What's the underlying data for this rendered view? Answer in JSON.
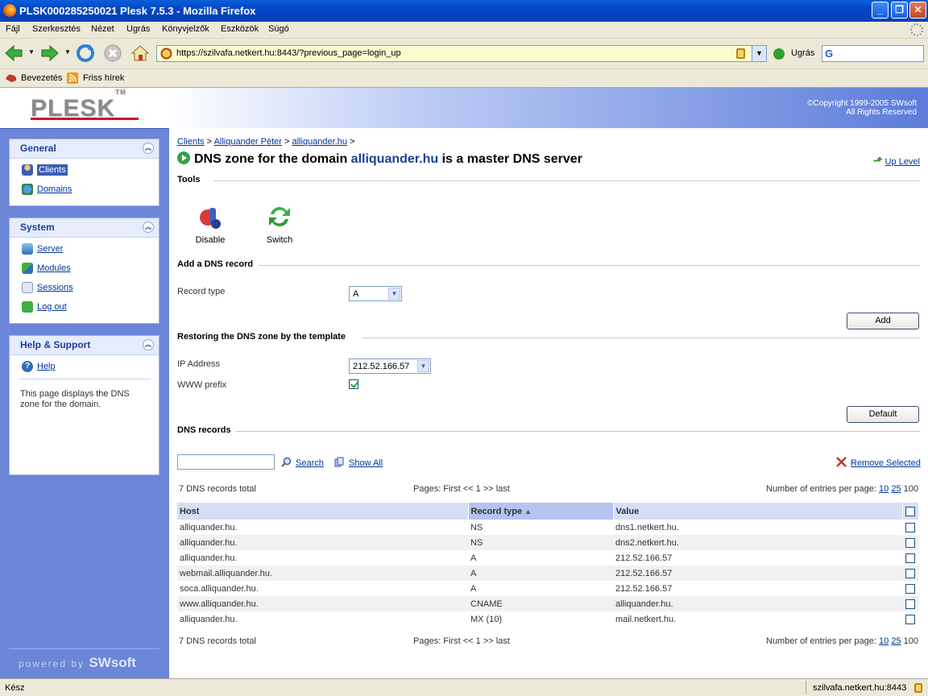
{
  "window": {
    "title": "PLSK000285250021 Plesk 7.5.3 - Mozilla Firefox"
  },
  "menu": [
    "Fájl",
    "Szerkesztés",
    "Nézet",
    "Ugrás",
    "Könyvjelzők",
    "Eszközök",
    "Súgó"
  ],
  "nav": {
    "url": "https://szilvafa.netkert.hu:8443/?previous_page=login_up",
    "go_label": "Ugrás",
    "search_placeholder": "G"
  },
  "bookmarks": [
    "Bevezetés",
    "Friss hírek"
  ],
  "header": {
    "logo": "PLESK",
    "tm": "TM",
    "copyright_line1": "©Copyright 1999-2005 SWsoft",
    "copyright_line2": "All Rights Reserved"
  },
  "sidebar": {
    "general": {
      "title": "General",
      "items": [
        "Clients",
        "Domains"
      ]
    },
    "system": {
      "title": "System",
      "items": [
        "Server",
        "Modules",
        "Sessions",
        "Log out"
      ]
    },
    "help": {
      "title": "Help & Support",
      "link": "Help",
      "text": "This page displays the DNS zone for the domain."
    },
    "powered_by": "powered by",
    "brand": "SWsoft"
  },
  "main": {
    "breadcrumb": [
      "Clients",
      "Alliquander Péter",
      "alliquander.hu"
    ],
    "title_pre": "DNS zone for the domain ",
    "title_domain": "alliquander.hu",
    "title_post": " is a master DNS server",
    "up_level": "Up Level",
    "tools_title": "Tools",
    "tools": [
      "Disable",
      "Switch"
    ],
    "add_title": "Add a DNS record",
    "record_type_label": "Record type",
    "record_type_value": "A",
    "add_button": "Add",
    "restore_title": "Restoring the DNS zone by the template",
    "ip_label": "IP Address",
    "ip_value": "212.52.166.57",
    "www_label": "WWW prefix",
    "default_button": "Default",
    "records_title": "DNS records",
    "search_link": "Search",
    "show_all_link": "Show All",
    "remove_selected": "Remove Selected",
    "total": "7 DNS records total",
    "pages": "Pages: First << 1 >> last",
    "entries_label": "Number of entries per page:",
    "entries_options": [
      "10",
      "25",
      "100"
    ],
    "columns": [
      "Host",
      "Record type",
      "Value"
    ],
    "rows": [
      [
        "alliquander.hu.",
        "NS",
        "dns1.netkert.hu."
      ],
      [
        "alliquander.hu.",
        "NS",
        "dns2.netkert.hu."
      ],
      [
        "alliquander.hu.",
        "A",
        "212.52.166.57"
      ],
      [
        "webmail.alliquander.hu.",
        "A",
        "212.52.166.57"
      ],
      [
        "soca.alliquander.hu.",
        "A",
        "212.52.166.57"
      ],
      [
        "www.alliquander.hu.",
        "CNAME",
        "alliquander.hu."
      ],
      [
        "alliquander.hu.",
        "MX (10)",
        "mail.netkert.hu."
      ]
    ]
  },
  "status": {
    "left": "Kész",
    "right": "szilvafa.netkert.hu:8443"
  }
}
